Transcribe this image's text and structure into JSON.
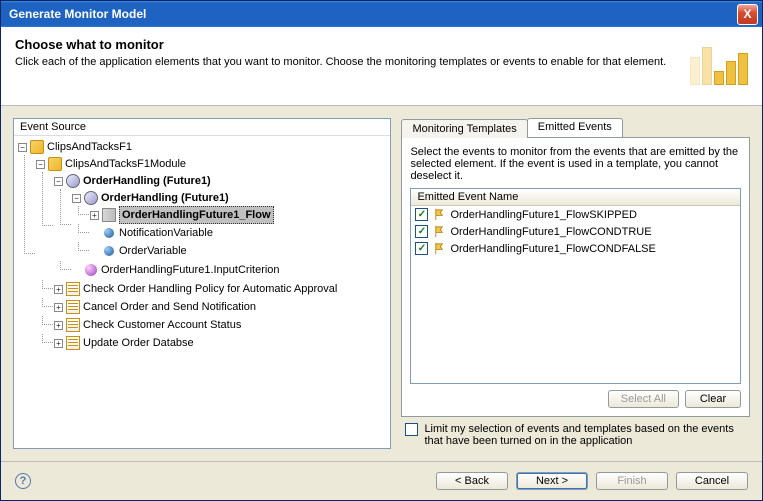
{
  "window": {
    "title": "Generate Monitor Model",
    "close": "X"
  },
  "header": {
    "heading": "Choose what to monitor",
    "subtext": "Click each of the application elements that you want to monitor. Choose the monitoring templates or events to enable for that element."
  },
  "tree": {
    "title": "Event Source",
    "root": "ClipsAndTacksF1",
    "module": "ClipsAndTacksF1Module",
    "oh1": "OrderHandling (Future1)",
    "oh2": "OrderHandling (Future1)",
    "flow": "OrderHandlingFuture1_Flow",
    "nvar": "NotificationVariable",
    "ovar": "OrderVariable",
    "ic": "OrderHandlingFuture1.InputCriterion",
    "tasks": [
      "Check Order Handling Policy for Automatic Approval",
      "Cancel Order and Send Notification",
      "Check Customer Account Status",
      "Update Order Databse"
    ]
  },
  "tabs": {
    "templates": "Monitoring Templates",
    "events": "Emitted Events"
  },
  "right": {
    "desc": "Select the events to monitor from the events that are emitted by the selected element. If the event is used in a template, you cannot deselect it.",
    "col": "Emitted Event Name",
    "events": [
      "OrderHandlingFuture1_FlowSKIPPED",
      "OrderHandlingFuture1_FlowCONDTRUE",
      "OrderHandlingFuture1_FlowCONDFALSE"
    ],
    "selectAll": "Select All",
    "clear": "Clear",
    "limit": "Limit my selection of events and templates based on the events that have been turned on in the application"
  },
  "footer": {
    "back": "< Back",
    "next": "Next >",
    "finish": "Finish",
    "cancel": "Cancel"
  }
}
